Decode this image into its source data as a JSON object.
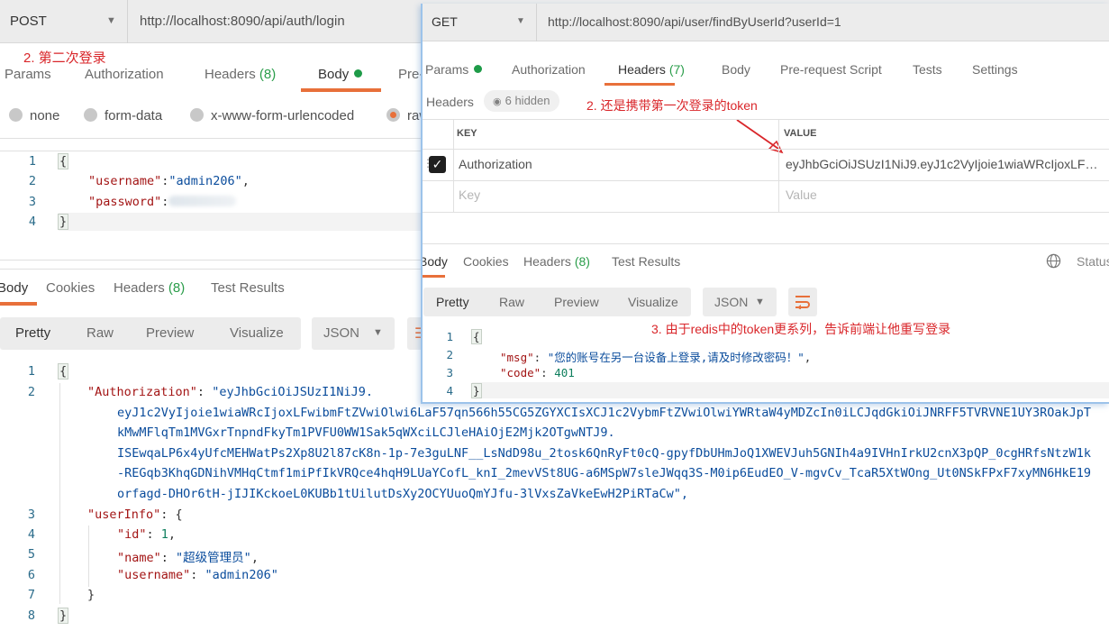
{
  "left_window": {
    "method": "POST",
    "url": "http://localhost:8090/api/auth/login",
    "annotation": "2. 第二次登录",
    "request_tabs": [
      {
        "label": "Params"
      },
      {
        "label": "Authorization"
      },
      {
        "label": "Headers",
        "count": "(8)"
      },
      {
        "label": "Body",
        "active": true,
        "has_dot": true
      },
      {
        "label": "Pre-"
      }
    ],
    "body_types": [
      {
        "label": "none",
        "selected": false
      },
      {
        "label": "form-data",
        "selected": false
      },
      {
        "label": "x-www-form-urlencoded",
        "selected": false
      },
      {
        "label": "raw",
        "selected": true
      }
    ],
    "request_body": {
      "line_numbers": [
        "1",
        "2",
        "3",
        "4"
      ],
      "open": "{",
      "username_key": "\"username\"",
      "username_val": "\"admin206\"",
      "password_key": "\"password\"",
      "password_val": "(blurred)",
      "close": "}"
    },
    "response_tabs": [
      {
        "label": "Body",
        "active": true
      },
      {
        "label": "Cookies"
      },
      {
        "label": "Headers",
        "count": "(8)"
      },
      {
        "label": "Test Results"
      }
    ],
    "view_modes": [
      "Pretty",
      "Raw",
      "Preview",
      "Visualize"
    ],
    "format": "JSON",
    "response_body": {
      "line_numbers": [
        "1",
        "2",
        "3",
        "4",
        "5",
        "6",
        "7",
        "8"
      ],
      "auth_key": "\"Authorization\"",
      "token_lines": [
        "\"eyJhbGciOiJSUzI1NiJ9.",
        "eyJ1c2VyIjoie1wiaWRcIjoxLFwibmFtZVwiOlwi6LaF57qn566h55CG5ZGYXCIsXCJ1c2VybmFtZVwiOlwiYWRtaW4yMDZcIn0iLCJqdGkiOiJNRFF5TVRVNE1UY3ROakJpT",
        "kMwMFlqTm1MVGxrTnpndFkyTm1PVFU0WW1Sak5qWXciLCJleHAiOjE2Mjk2OTgwNTJ9.",
        "ISEwqaLP6x4yUfcMEHWatPs2Xp8U2l87cK8n-1p-7e3guLNF__LsNdD98u_2tosk6QnRyFt0cQ-gpyfDbUHmJoQ1XWEVJuh5GNIh4a9IVHnIrkU2cnX3pQP_0cgHRfsNtzW1k",
        "-REGqb3KhqGDNihVMHqCtmf1miPfIkVRQce4hqH9LUaYCofL_knI_2mevVSt8UG-a6MSpW7sleJWqq3S-M0ip6EudEO_V-mgvCv_TcaR5XtWOng_Ut0NSkFPxF7xyMN6HkE19",
        "orfagd-DHOr6tH-jIJIKckoeL0KUBb1tUilutDsXy2OCYUuoQmYJfu-3lVxsZaVkeEwH2PiRTaCw\","
      ],
      "userinfo_key": "\"userInfo\"",
      "id_key": "\"id\"",
      "id_val": "1",
      "name_key": "\"name\"",
      "name_val": "\"超级管理员\"",
      "username_key": "\"username\"",
      "username_val": "\"admin206\""
    }
  },
  "right_window": {
    "method": "GET",
    "url": "http://localhost:8090/api/user/findByUserId?userId=1",
    "request_tabs": [
      {
        "label": "Params",
        "has_dot": true
      },
      {
        "label": "Authorization"
      },
      {
        "label": "Headers",
        "count": "(7)",
        "active": true
      },
      {
        "label": "Body"
      },
      {
        "label": "Pre-request Script"
      },
      {
        "label": "Tests"
      },
      {
        "label": "Settings"
      }
    ],
    "headers_label": "Headers",
    "hidden_count": "6 hidden",
    "annotation_token": "2. 还是携带第一次登录的token",
    "table_headers": {
      "key": "KEY",
      "value": "VALUE"
    },
    "rows": [
      {
        "checked": true,
        "key": "Authorization",
        "value": "eyJhbGciOiJSUzI1NiJ9.eyJ1c2VyIjoie1wiaWRcIjoxLFwib..."
      }
    ],
    "placeholder_row": {
      "key": "Key",
      "value": "Value"
    },
    "response_tabs": [
      {
        "label": "Body",
        "active": true
      },
      {
        "label": "Cookies"
      },
      {
        "label": "Headers",
        "count": "(8)"
      },
      {
        "label": "Test Results"
      }
    ],
    "status_label": "Status",
    "view_modes": [
      "Pretty",
      "Raw",
      "Preview",
      "Visualize"
    ],
    "format": "JSON",
    "annotation_redis": "3. 由于redis中的token更系列，告诉前端让他重写登录",
    "response_body": {
      "line_numbers": [
        "1",
        "2",
        "3",
        "4"
      ],
      "msg_key": "\"msg\"",
      "msg_val": "\"您的账号在另一台设备上登录,请及时修改密码！\"",
      "code_key": "\"code\"",
      "code_val": "401"
    }
  },
  "colors": {
    "accent_orange": "#e8703a",
    "status_green": "#1e9b48",
    "annotation_red": "#d9262a",
    "window_border_blue": "#9cc3ea"
  }
}
